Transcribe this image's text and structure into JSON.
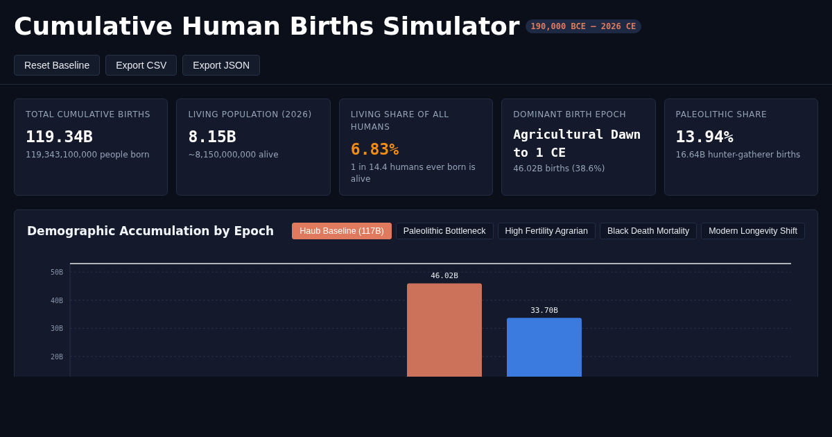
{
  "header": {
    "title": "Cumulative Human Births Simulator",
    "badge": "190,000 BCE – 2026 CE",
    "buttons": [
      "Reset Baseline",
      "Export CSV",
      "Export JSON"
    ]
  },
  "stats": [
    {
      "label": "TOTAL CUMULATIVE BIRTHS",
      "value": "119.34B",
      "detail": "119,343,100,000 people born",
      "kind": "plain"
    },
    {
      "label": "LIVING POPULATION (2026)",
      "value": "8.15B",
      "detail": "~8,150,000,000 alive",
      "kind": "plain"
    },
    {
      "label": "LIVING SHARE OF ALL HUMANS",
      "value": "6.83%",
      "detail": "1 in 14.4 humans ever born is alive",
      "kind": "highlight"
    },
    {
      "label": "DOMINANT BIRTH EPOCH",
      "value": "Agricultural Dawn to 1 CE",
      "detail": "46.02B births (38.6%)",
      "kind": "plain"
    },
    {
      "label": "PALEOLITHIC SHARE",
      "value": "13.94%",
      "detail": "16.64B hunter-gatherer births",
      "kind": "plain"
    }
  ],
  "chart_panel": {
    "title": "Demographic Accumulation by Epoch",
    "scenarios": [
      {
        "label": "Haub Baseline (117B)",
        "selected": true
      },
      {
        "label": "Paleolithic Bottleneck",
        "selected": false
      },
      {
        "label": "High Fertility Agrarian",
        "selected": false
      },
      {
        "label": "Black Death Mortality",
        "selected": false
      },
      {
        "label": "Modern Longevity Shift",
        "selected": false
      }
    ],
    "chart_data": {
      "type": "bar",
      "grid": true,
      "ylim": [
        0,
        53
      ],
      "yticks": [
        {
          "value": 20,
          "label": "20B"
        },
        {
          "value": 30,
          "label": "30B"
        },
        {
          "value": 40,
          "label": "40B"
        },
        {
          "value": 50,
          "label": "50B"
        }
      ],
      "series": [
        {
          "color": "#cc725a",
          "values": [
            null,
            null,
            null,
            46.0,
            null,
            null,
            null
          ]
        },
        {
          "color": "#3b7be0",
          "values": [
            null,
            null,
            null,
            null,
            33.7,
            null,
            null
          ]
        }
      ],
      "value_labels": [
        null,
        null,
        null,
        "46.02B",
        "33.70B",
        null,
        null
      ]
    }
  }
}
